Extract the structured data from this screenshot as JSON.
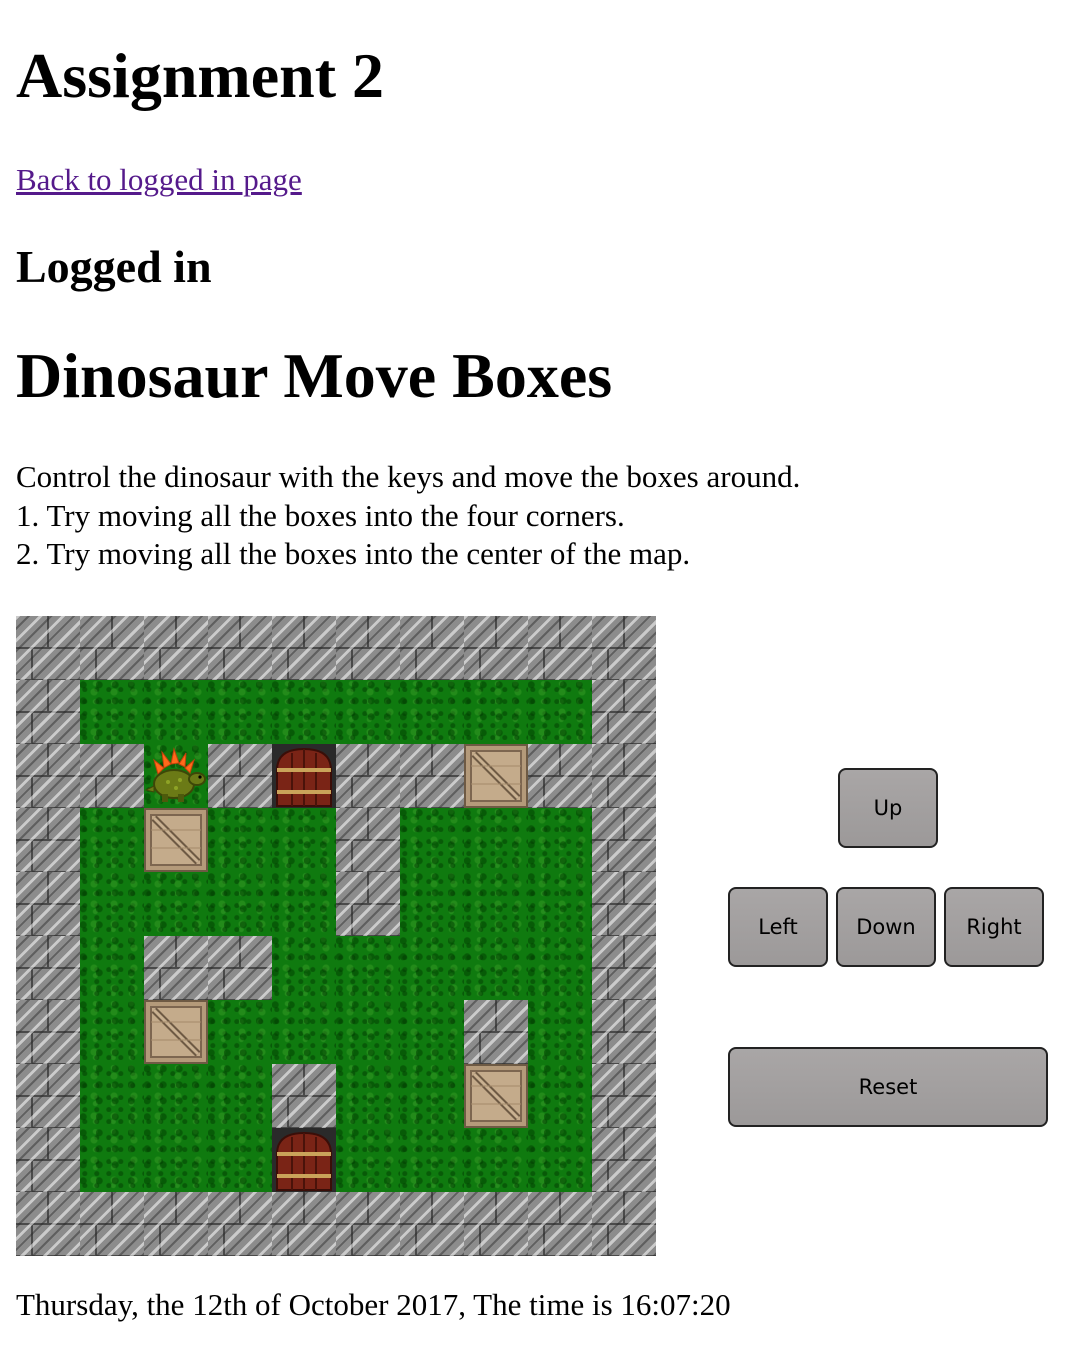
{
  "header": {
    "title": "Assignment 2",
    "back_link": "Back to logged in page",
    "status": "Logged in"
  },
  "game": {
    "title": "Dinosaur Move Boxes",
    "instructions": [
      "Control the dinosaur with the keys and move the boxes around.",
      "1. Try moving all the boxes into the four corners.",
      "2. Try moving all the boxes into the center of the map."
    ],
    "map": [
      "WWWWWWWWWW",
      "WGGGGGGGGW",
      "WWPWDWWBWW",
      "WGBGGWGGGW",
      "WGGGGWGGGW",
      "WGWWGGGGGW",
      "WGBGGGGWGW",
      "WGGGWGGBGW",
      "WGGGDGGGGW",
      "WWWWWWWWWW"
    ],
    "legend": {
      "W": "stone-wall",
      "G": "grass",
      "B": "wooden-box",
      "D": "door",
      "P": "dinosaur-player"
    }
  },
  "controls": {
    "up": "Up",
    "left": "Left",
    "down": "Down",
    "right": "Right",
    "reset": "Reset"
  },
  "footer": {
    "datetime": "Thursday, the 12th of October 2017, The time is 16:07:20"
  }
}
